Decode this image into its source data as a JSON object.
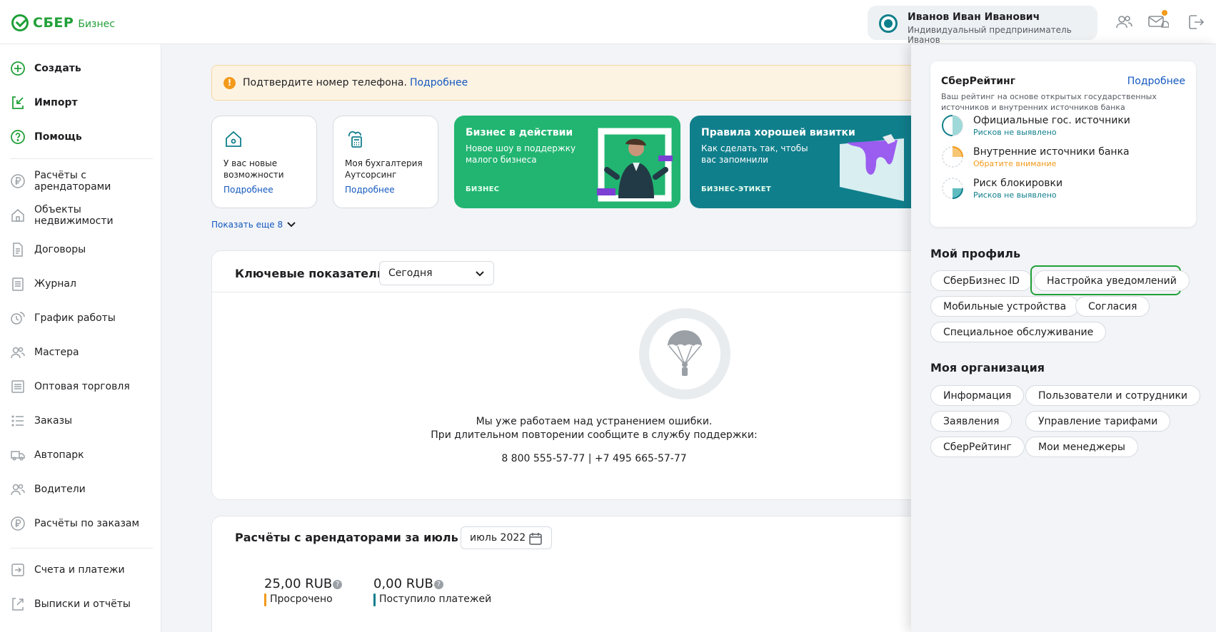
{
  "header": {
    "logo_text": "СБЕР",
    "logo_sub": "Бизнес",
    "user_name": "Иванов Иван Иванович",
    "user_org": "Индивидуальный предприниматель Иванов",
    "icons": [
      "users-icon",
      "mail-bell-icon",
      "logout-icon"
    ],
    "notification_color": "#f29a1a"
  },
  "sidebar": {
    "primary": [
      {
        "label": "Создать",
        "icon": "plus-circle-icon"
      },
      {
        "label": "Импорт",
        "icon": "import-icon"
      },
      {
        "label": "Помощь",
        "icon": "help-icon"
      }
    ],
    "items": [
      {
        "label": "Расчёты с арендаторами",
        "icon": "ruble-icon"
      },
      {
        "label": "Объекты недвижимости",
        "icon": "house-icon"
      },
      {
        "label": "Договоры",
        "icon": "document-icon"
      },
      {
        "label": "Журнал",
        "icon": "journal-icon"
      },
      {
        "label": "График работы",
        "icon": "schedule-icon"
      },
      {
        "label": "Мастера",
        "icon": "people-icon"
      },
      {
        "label": "Оптовая торговля",
        "icon": "wholesale-icon"
      },
      {
        "label": "Заказы",
        "icon": "list-icon"
      },
      {
        "label": "Автопарк",
        "icon": "truck-icon"
      },
      {
        "label": "Водители",
        "icon": "drivers-icon"
      },
      {
        "label": "Расчёты по заказам",
        "icon": "ruble-icon"
      }
    ],
    "bottom": [
      {
        "label": "Счета и платежи",
        "icon": "payments-icon"
      },
      {
        "label": "Выписки и отчёты",
        "icon": "reports-icon"
      }
    ]
  },
  "alert": {
    "text": "Подтвердите номер телефона.",
    "link": "Подробнее",
    "icon": "warning-icon"
  },
  "cards": [
    {
      "text": "У вас новые возможности",
      "link": "Подробнее",
      "icon": "house-icon"
    },
    {
      "text": "Моя бухгалтерия Аутсорсинг",
      "link": "Подробнее",
      "icon": "calculator-icon"
    }
  ],
  "promos": [
    {
      "title": "Бизнес в действии",
      "subtitle": "Новое шоу в поддержку малого бизнеса",
      "tag": "БИЗНЕС",
      "color": "#21b571"
    },
    {
      "title": "Правила хорошей визитки",
      "subtitle": "Как сделать так, чтобы вас запомнили",
      "tag": "БИЗНЕС-ЭТИКЕТ",
      "color": "#107f8c"
    }
  ],
  "show_more": "Показать еще 8",
  "key_metrics": {
    "title": "Ключевые показатели",
    "period": "Сегодня",
    "error_line1": "Мы уже работаем над устранением ошибки.",
    "error_line2": "При длительном повторении сообщите в службу поддержки:",
    "phones": "8 800 555-57-77 | +7 495 665-57-77"
  },
  "tenants": {
    "title": "Расчёты с арендаторами за июль 2022",
    "period": "июль 2022",
    "overdue_value": "25,00 RUB",
    "overdue_label": "Просрочено",
    "received_value": "0,00 RUB",
    "received_label": "Поступило платежей"
  },
  "rating": {
    "title": "СберРейтинг",
    "more": "Подробнее",
    "desc": "Ваш рейтинг на основе открытых государственных источников и внутренних источников банка",
    "rows": [
      {
        "name": "Официальные гос. источники",
        "status": "Рисков не выявлено",
        "level": "ok"
      },
      {
        "name": "Внутренние источники банка",
        "status": "Обратите внимание",
        "level": "warn"
      },
      {
        "name": "Риск блокировки",
        "status": "Рисков не выявлено",
        "level": "ok"
      }
    ]
  },
  "profile": {
    "title": "Мой профиль",
    "chips": [
      "СберБизнес ID",
      "Настройка уведомлений",
      "Мобильные устройства",
      "Согласия",
      "Специальное обслуживание"
    ]
  },
  "organization": {
    "title": "Моя организация",
    "chips": [
      "Информация",
      "Пользователи и сотрудники",
      "Заявления",
      "Управление тарифами",
      "СберРейтинг",
      "Мои менеджеры"
    ]
  }
}
